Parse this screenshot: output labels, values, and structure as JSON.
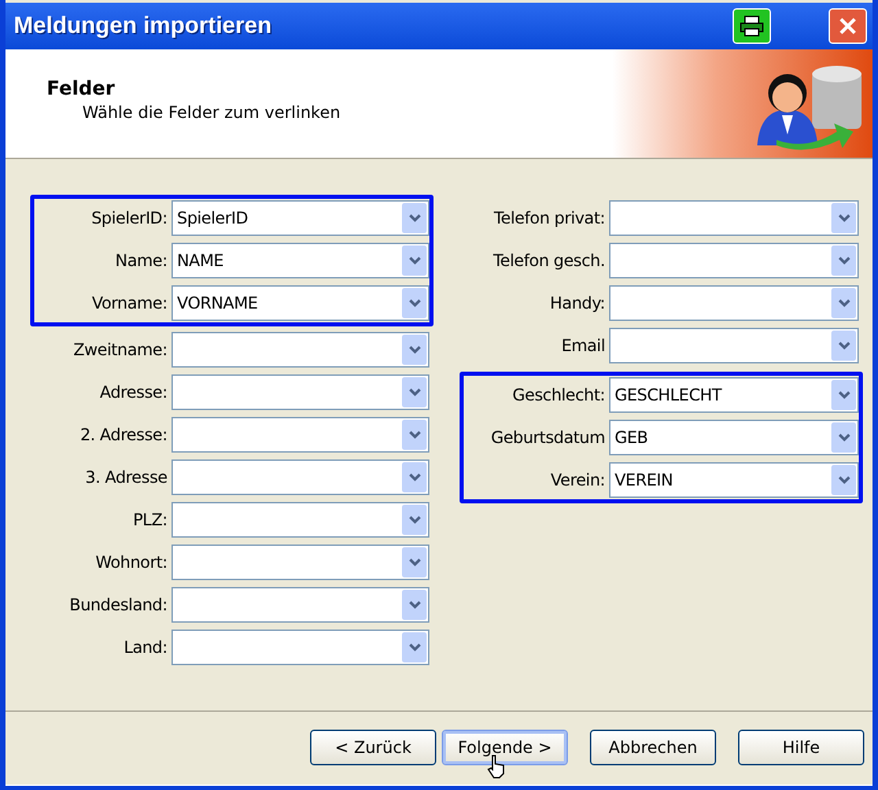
{
  "window": {
    "title": "Meldungen importieren"
  },
  "header": {
    "title": "Felder",
    "subtitle": "Wähle die Felder zum verlinken"
  },
  "columns": [
    {
      "groups": [
        {
          "highlighted": true,
          "fields": [
            {
              "label": "SpielerID:",
              "value": "SpielerID"
            },
            {
              "label": "Name:",
              "value": "NAME"
            },
            {
              "label": "Vorname:",
              "value": "VORNAME"
            }
          ]
        },
        {
          "highlighted": false,
          "fields": [
            {
              "label": "Zweitname:"
            },
            {
              "label": "Adresse:"
            },
            {
              "label": "2. Adresse:"
            },
            {
              "label": "3. Adresse"
            },
            {
              "label": "PLZ:"
            },
            {
              "label": "Wohnort:"
            },
            {
              "label": "Bundesland:"
            },
            {
              "label": "Land:"
            }
          ]
        }
      ]
    },
    {
      "groups": [
        {
          "highlighted": false,
          "fields": [
            {
              "label": "Telefon privat:"
            },
            {
              "label": "Telefon gesch."
            },
            {
              "label": "Handy:"
            },
            {
              "label": "Email"
            }
          ]
        },
        {
          "highlighted": true,
          "fields": [
            {
              "label": "Geschlecht:",
              "value": "GESCHLECHT"
            },
            {
              "label": "Geburtsdatum",
              "value": "GEB"
            },
            {
              "label": "Verein:",
              "value": "VEREIN"
            }
          ]
        }
      ]
    }
  ],
  "buttons": [
    {
      "label": "< Zurück",
      "focused": false
    },
    {
      "label": "Folgende >",
      "focused": true
    },
    {
      "label": "Abbrechen",
      "focused": false
    },
    {
      "label": "Hilfe",
      "focused": false
    }
  ]
}
